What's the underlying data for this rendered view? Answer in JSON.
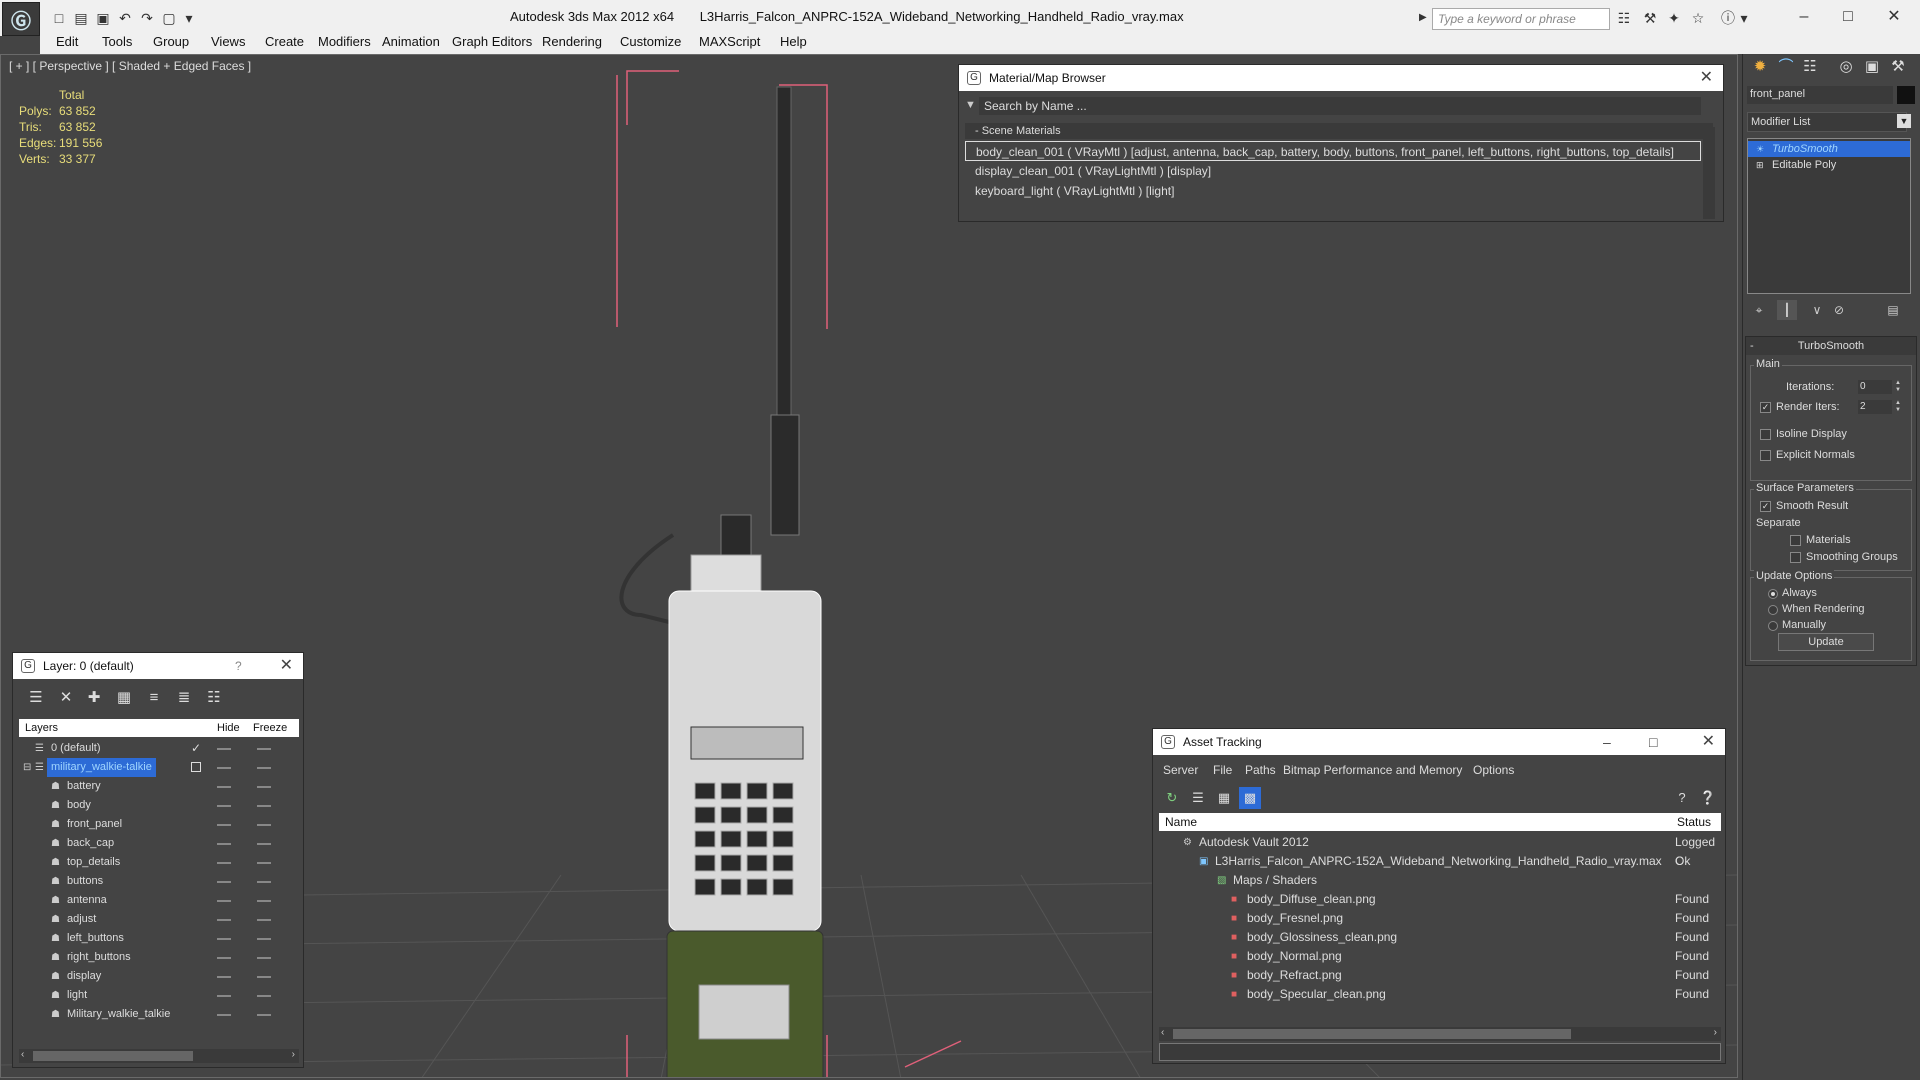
{
  "app": {
    "title": "Autodesk 3ds Max  2012 x64",
    "file": "L3Harris_Falcon_ANPRC-152A_Wideband_Networking_Handheld_Radio_vray.max",
    "search_placeholder": "Type a keyword or phrase"
  },
  "menu": [
    "Edit",
    "Tools",
    "Group",
    "Views",
    "Create",
    "Modifiers",
    "Animation",
    "Graph Editors",
    "Rendering",
    "Customize",
    "MAXScript",
    "Help"
  ],
  "viewport": {
    "label": "[ + ] [ Perspective ] [ Shaded + Edged Faces ]",
    "stats": {
      "header": "Total",
      "rows": [
        {
          "label": "Polys:",
          "value": "63 852"
        },
        {
          "label": "Tris:",
          "value": "63 852"
        },
        {
          "label": "Edges:",
          "value": "191 556"
        },
        {
          "label": "Verts:",
          "value": "33 377"
        }
      ]
    }
  },
  "material_browser": {
    "title": "Material/Map Browser",
    "search": "Search by Name ...",
    "section": "- Scene Materials",
    "materials": [
      "body_clean_001 ( VRayMtl ) [adjust, antenna, back_cap, battery, body, buttons, front_panel, left_buttons, right_buttons, top_details]",
      "display_clean_001 ( VRayLightMtl ) [display]",
      "keyboard_light ( VRayLightMtl ) [light]"
    ]
  },
  "layer_panel": {
    "title": "Layer: 0 (default)",
    "help": "?",
    "col_layers": "Layers",
    "col_hide": "Hide",
    "col_freeze": "Freeze",
    "layers": [
      {
        "name": "0 (default)",
        "level": 0
      },
      {
        "name": "military_walkie-talkie",
        "level": 0
      },
      {
        "name": "battery",
        "level": 1
      },
      {
        "name": "body",
        "level": 1
      },
      {
        "name": "front_panel",
        "level": 1
      },
      {
        "name": "back_cap",
        "level": 1
      },
      {
        "name": "top_details",
        "level": 1
      },
      {
        "name": "buttons",
        "level": 1
      },
      {
        "name": "antenna",
        "level": 1
      },
      {
        "name": "adjust",
        "level": 1
      },
      {
        "name": "left_buttons",
        "level": 1
      },
      {
        "name": "right_buttons",
        "level": 1
      },
      {
        "name": "display",
        "level": 1
      },
      {
        "name": "light",
        "level": 1
      },
      {
        "name": "Military_walkie_talkie",
        "level": 1
      }
    ]
  },
  "asset_tracking": {
    "title": "Asset Tracking",
    "menu": [
      "Server",
      "File",
      "Paths",
      "Bitmap Performance and Memory",
      "Options"
    ],
    "col_name": "Name",
    "col_status": "Status",
    "rows": [
      {
        "name": "Autodesk Vault 2012",
        "status": "Logged C",
        "level": 0
      },
      {
        "name": "L3Harris_Falcon_ANPRC-152A_Wideband_Networking_Handheld_Radio_vray.max",
        "status": "Ok",
        "level": 1
      },
      {
        "name": "Maps / Shaders",
        "status": "",
        "level": 2
      },
      {
        "name": "body_Diffuse_clean.png",
        "status": "Found",
        "level": 3
      },
      {
        "name": "body_Fresnel.png",
        "status": "Found",
        "level": 3
      },
      {
        "name": "body_Glossiness_clean.png",
        "status": "Found",
        "level": 3
      },
      {
        "name": "body_Normal.png",
        "status": "Found",
        "level": 3
      },
      {
        "name": "body_Refract.png",
        "status": "Found",
        "level": 3
      },
      {
        "name": "body_Specular_clean.png",
        "status": "Found",
        "level": 3
      }
    ]
  },
  "command_panel": {
    "object_name": "front_panel",
    "modifier_list": "Modifier List",
    "stack": [
      "TurboSmooth",
      "Editable Poly"
    ],
    "rollout_title": "TurboSmooth",
    "main_label": "Main",
    "iterations_label": "Iterations:",
    "iterations_value": "0",
    "render_iters_label": "Render Iters:",
    "render_iters_value": "2",
    "isoline_label": "Isoline Display",
    "explicit_normals_label": "Explicit Normals",
    "surface_label": "Surface Parameters",
    "smooth_result_label": "Smooth Result",
    "separate_label": "Separate",
    "materials_label": "Materials",
    "smoothing_groups_label": "Smoothing Groups",
    "update_options_label": "Update Options",
    "always_label": "Always",
    "when_rendering_label": "When Rendering",
    "manually_label": "Manually",
    "update_button": "Update"
  }
}
